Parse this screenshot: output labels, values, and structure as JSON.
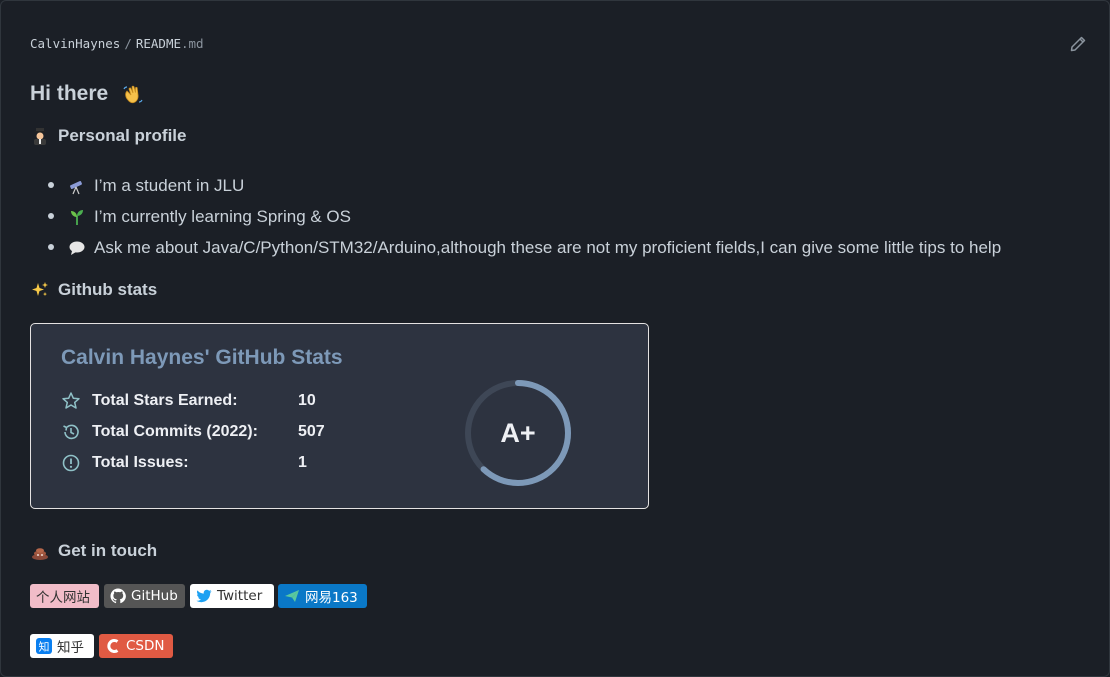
{
  "header": {
    "owner": "CalvinHaynes",
    "separator": "/",
    "file_base": "README",
    "file_ext": ".md"
  },
  "intro": {
    "greeting": "Hi there",
    "greeting_emoji": "waving-hand"
  },
  "profile": {
    "heading": "Personal profile",
    "heading_emoji": "student",
    "items": [
      {
        "emoji": "telescope",
        "text": "I’m a student in JLU"
      },
      {
        "emoji": "seedling",
        "text": "I’m currently learning Spring & OS"
      },
      {
        "emoji": "speech-balloon",
        "text": "Ask me about Java/C/Python/STM32/Arduino,although these are not my proficient fields,I can give some little tips to help"
      }
    ]
  },
  "stats_section": {
    "heading": "Github stats",
    "heading_emoji": "sparkles"
  },
  "stats_card": {
    "title": "Calvin Haynes' GitHub Stats",
    "rows": [
      {
        "icon": "star-icon",
        "label": "Total Stars Earned:",
        "value": "10"
      },
      {
        "icon": "history-icon",
        "label": "Total Commits (2022):",
        "value": "507"
      },
      {
        "icon": "issue-icon",
        "label": "Total Issues:",
        "value": "1"
      }
    ],
    "rank": "A+",
    "rank_progress": 0.62,
    "colors": {
      "background": "#2d3340",
      "title": "#7d99b8",
      "text": "#eef0f4",
      "icon": "#8fc1c7",
      "ring": "#7d99b8"
    }
  },
  "contact": {
    "heading": "Get in touch",
    "heading_emoji": "pile-of-poo",
    "badges": [
      {
        "label": "个人网站",
        "icon": "",
        "bg": "#f1bcc8",
        "color": "#333333"
      },
      {
        "label": "GitHub",
        "icon": "github-icon",
        "bg": "#555555",
        "color": "#ffffff"
      },
      {
        "label": "Twitter",
        "icon": "twitter-icon",
        "bg": "#ffffff",
        "color": "#333333"
      },
      {
        "label": "网易163",
        "icon": "send-icon",
        "bg": "#0a78c7",
        "color": "#ffffff"
      },
      {
        "label": "知乎",
        "icon": "zhihu-icon",
        "bg": "#ffffff",
        "color": "#333333"
      },
      {
        "label": "CSDN",
        "icon": "csdn-icon",
        "bg": "#e05a43",
        "color": "#ffffff"
      }
    ]
  }
}
